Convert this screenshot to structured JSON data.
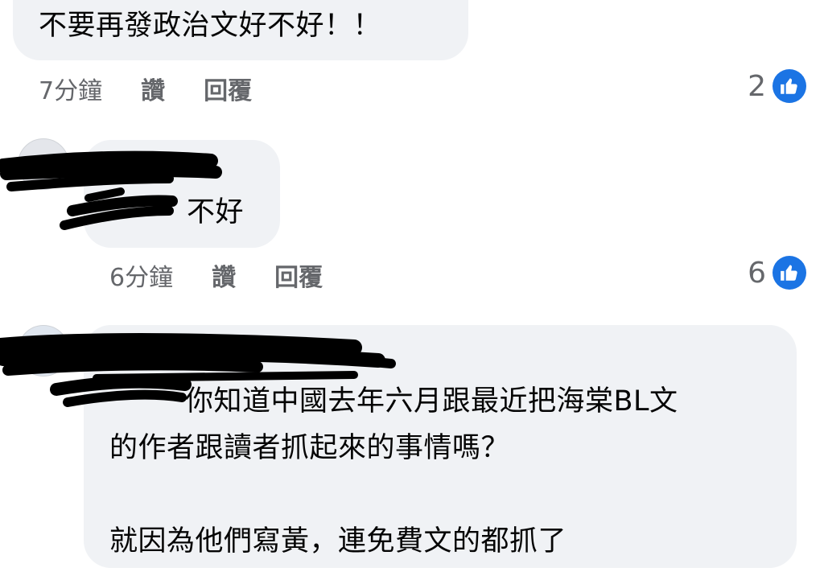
{
  "comments": [
    {
      "text": "不要再發政治文好不好！！",
      "time": "7分鐘",
      "like_label": "讚",
      "reply_label": "回覆",
      "reaction_count": "2"
    },
    {
      "text": "不好",
      "time": "6分鐘",
      "like_label": "讚",
      "reply_label": "回覆",
      "reaction_count": "6"
    },
    {
      "lines": [
        "你知道中國去年六月跟最近把海棠BL文",
        "的作者跟讀者抓起來的事情嗎？",
        "",
        "就因為他們寫黃，連免費文的都抓了"
      ]
    }
  ],
  "colors": {
    "bubble": "#f0f2f5",
    "meta_text": "#65676b",
    "like_icon": "#1b74e4",
    "redaction": "#000000"
  },
  "icons": {
    "reaction": "thumbs-up-icon",
    "avatar": "avatar"
  }
}
